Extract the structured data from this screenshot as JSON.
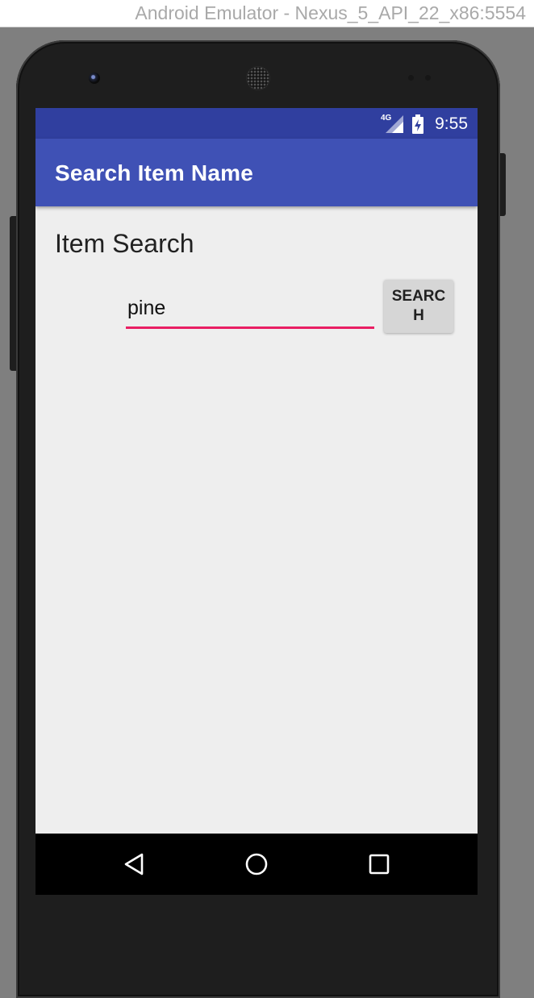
{
  "window": {
    "title": "Android Emulator - Nexus_5_API_22_x86:5554"
  },
  "status_bar": {
    "network": "4G",
    "time": "9:55",
    "icons": [
      "signal-icon",
      "battery-icon"
    ]
  },
  "app_bar": {
    "title": "Search Item Name"
  },
  "main": {
    "heading": "Item Search",
    "search": {
      "value": "pine",
      "placeholder": ""
    },
    "search_button_label": "SEARCH"
  },
  "nav_bar": {
    "icons": [
      "back-icon",
      "home-icon",
      "recent-apps-icon"
    ]
  },
  "colors": {
    "status_bar": "#303f9f",
    "app_bar": "#3f51b5",
    "accent": "#e91e63",
    "screen_background": "#eeeeee"
  }
}
